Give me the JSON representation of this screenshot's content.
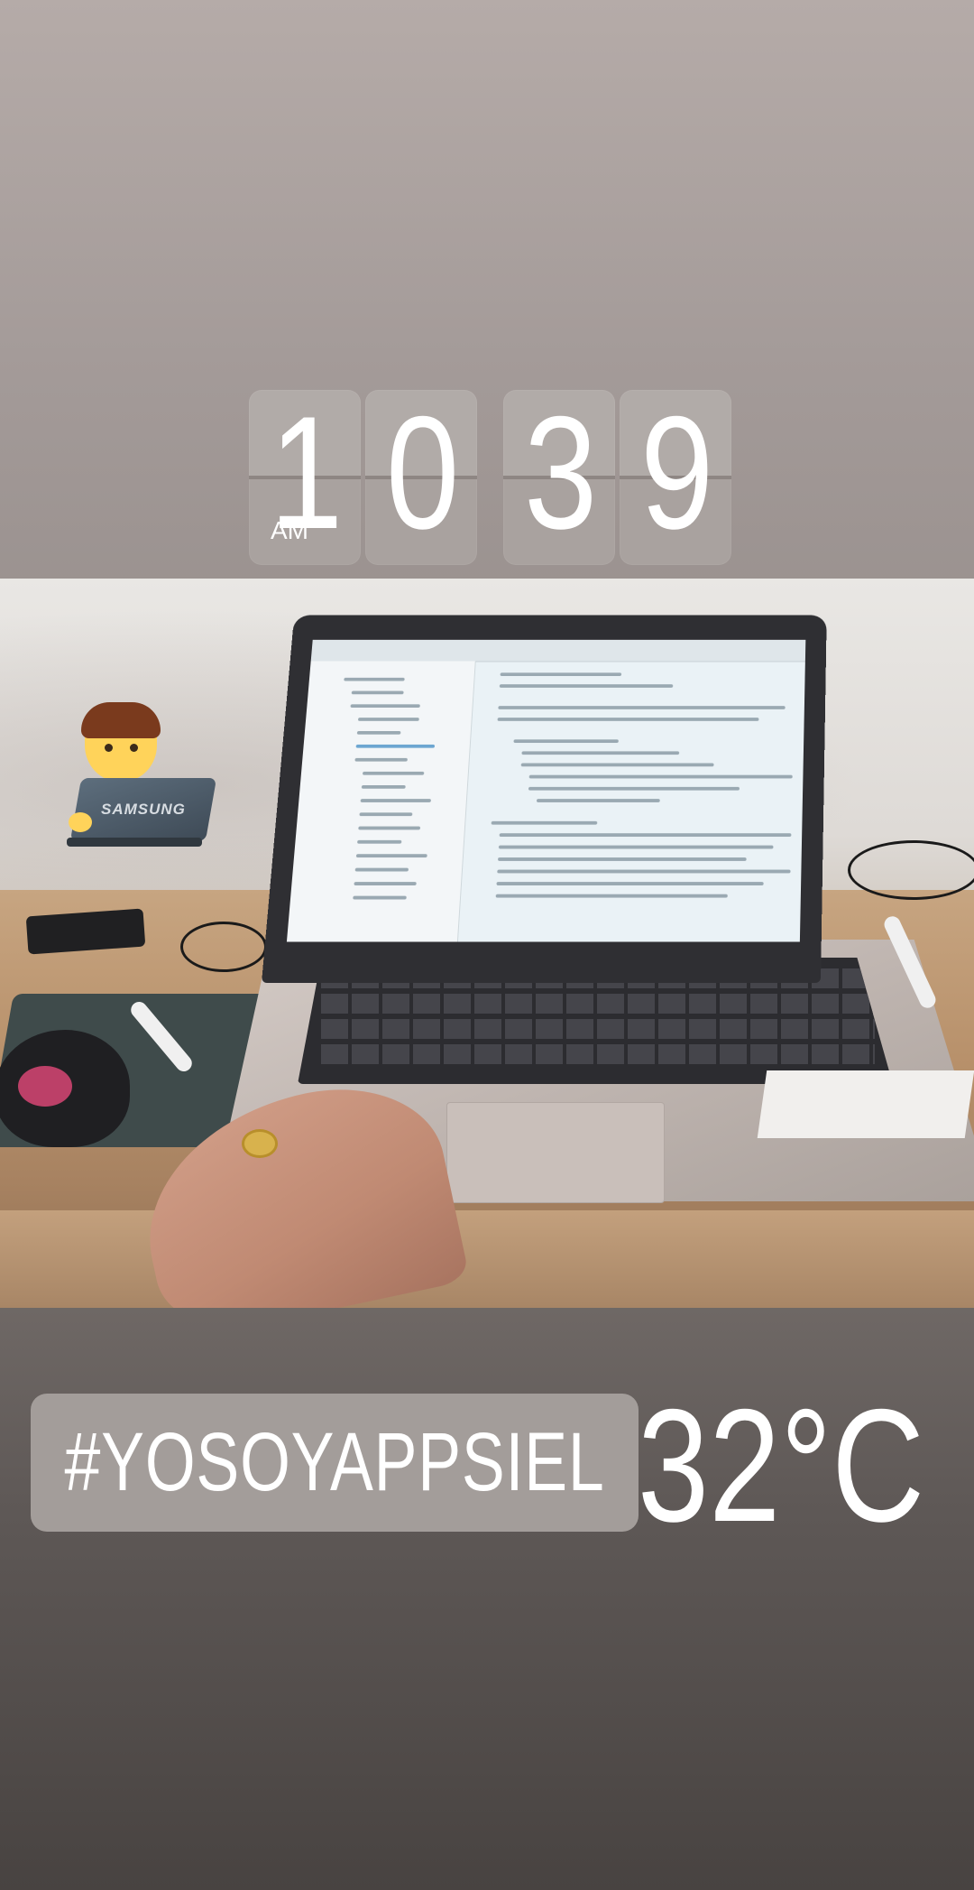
{
  "clock": {
    "hour_tens": "1",
    "hour_ones": "0",
    "minute_tens": "3",
    "minute_ones": "9",
    "period": "AM"
  },
  "sticker_laptop": {
    "brand": "SAMSUNG",
    "icon": "man-technologist-emoji"
  },
  "hashtag": {
    "text": "#YOSOYAPPSIEL"
  },
  "weather": {
    "temperature": "32°C"
  },
  "colors": {
    "background_top": "#b5aba8",
    "background_bottom": "#484341",
    "tile": "#a9a29f",
    "hashtag_box": "#a39d9a",
    "text": "#ffffff"
  }
}
